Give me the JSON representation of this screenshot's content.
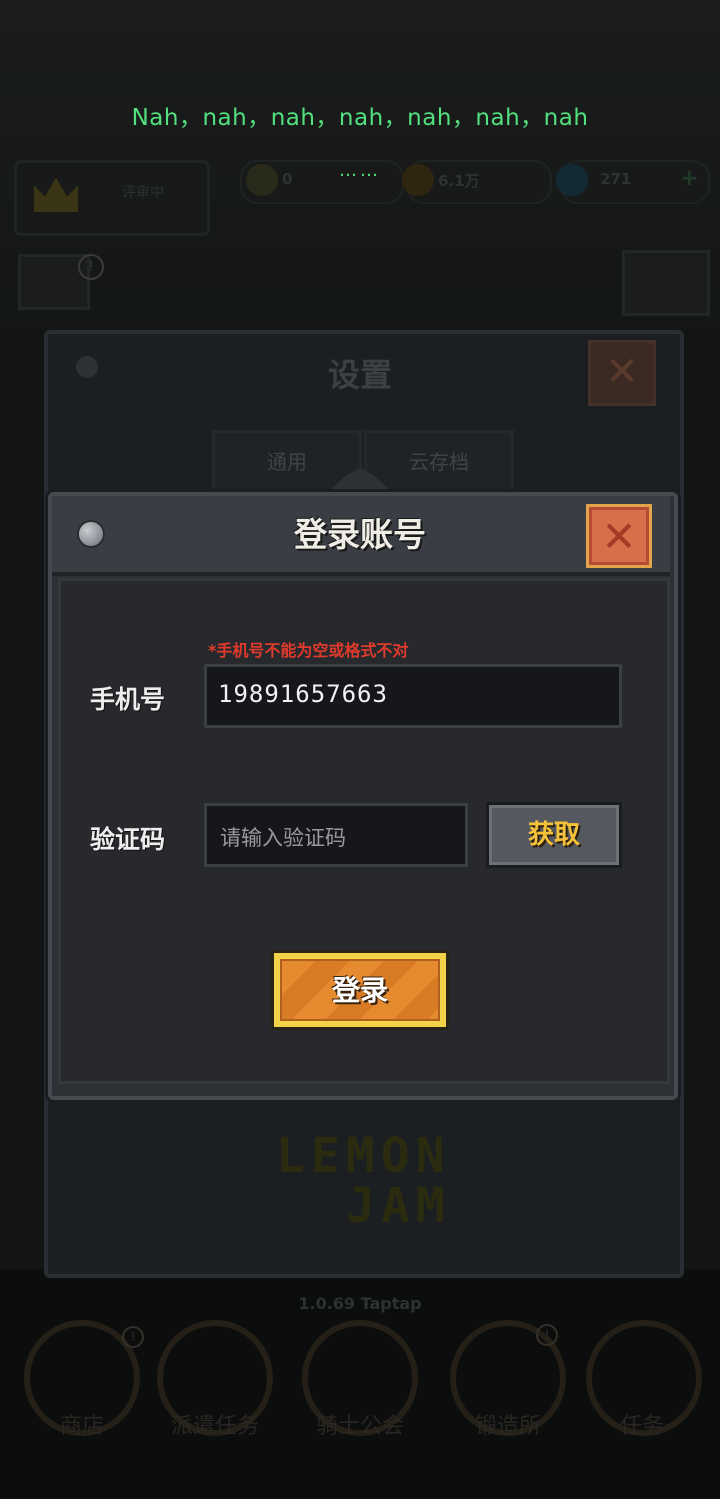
{
  "overlay": {
    "lyric": "Nah，nah，nah，nah，nah，nah，nah",
    "dots": "……"
  },
  "hud": {
    "rank_label": "评审中",
    "res1": "0",
    "res2": "6.1万",
    "res3": "271",
    "plus": "+",
    "alert": "!"
  },
  "settings": {
    "title": "设置",
    "close": "✕",
    "tabs": [
      "通用",
      "云存档"
    ],
    "logo_line1": "LEMON",
    "logo_line2": "JAM",
    "version": "1.0.69 Taptap"
  },
  "bottom_nav": {
    "items": [
      "商店",
      "派遣任务",
      "骑士公会",
      "锻造所",
      "任务"
    ]
  },
  "dialog": {
    "title": "登录账号",
    "close": "✕",
    "error": "*手机号不能为空或格式不对",
    "phone_label": "手机号",
    "phone_value": "19891657663",
    "code_label": "验证码",
    "code_placeholder": "请输入验证码",
    "get_code": "获取",
    "login": "登录"
  },
  "colors": {
    "lyric": "#52e07e",
    "error": "#e03a2c",
    "accent_gold": "#f5c23a",
    "login_orange": "#e58a2e"
  }
}
